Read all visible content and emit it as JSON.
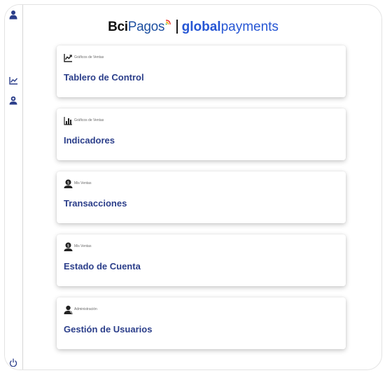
{
  "brand": {
    "bci": "Bci",
    "pagos": "Pagos",
    "gp_g": "g",
    "gp_global": "lobal",
    "gp_payments": "payments"
  },
  "cards": [
    {
      "category": "Gráficos de Ventas",
      "title": "Tablero de Control",
      "icon": "line-chart-icon"
    },
    {
      "category": "Gráficos de Ventas",
      "title": "Indicadores",
      "icon": "bar-chart-icon"
    },
    {
      "category": "Mis Ventas",
      "title": "Transacciones",
      "icon": "money-user-icon"
    },
    {
      "category": "Mis Ventas",
      "title": "Estado de Cuenta",
      "icon": "money-user-icon"
    },
    {
      "category": "Administración",
      "title": "Gestión de Usuarios",
      "icon": "users-icon"
    }
  ],
  "colors": {
    "title": "#2b3e8a",
    "brand_blue": "#2656d4",
    "rail_icon": "#2b3e8a"
  }
}
